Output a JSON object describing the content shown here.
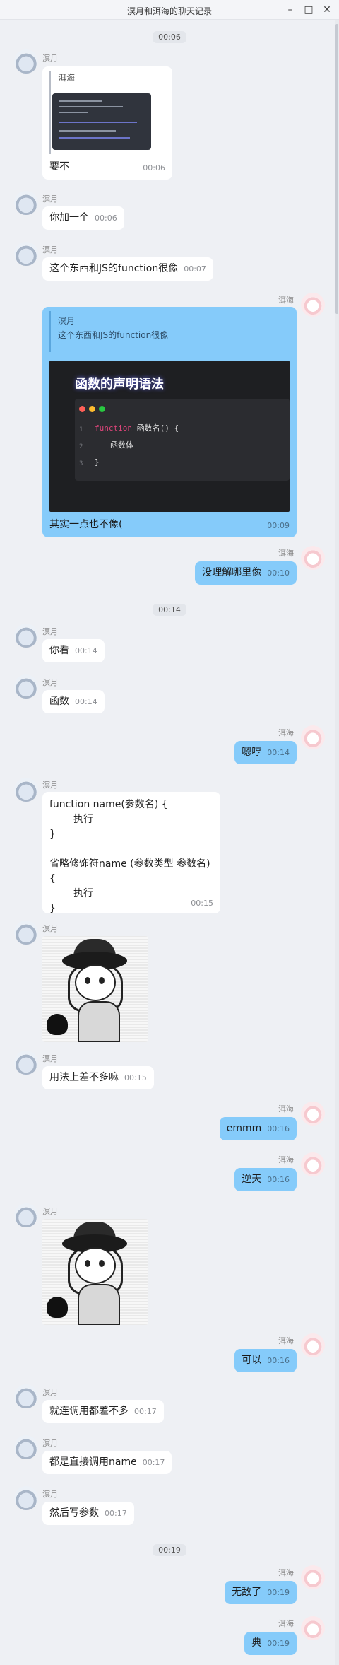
{
  "window": {
    "title": "溟月和洱海的聊天记录",
    "minimize_icon": "minimize-icon",
    "maximize_icon": "maximize-icon",
    "close_icon": "close-icon"
  },
  "users": {
    "left": "溟月",
    "right": "洱海"
  },
  "time_separators": [
    "00:06",
    "00:14",
    "00:19"
  ],
  "messages": [
    {
      "from": "left",
      "quote_name": "洱海",
      "text": "要不",
      "time": "00:06"
    },
    {
      "from": "left",
      "text": "你加一个",
      "time": "00:06"
    },
    {
      "from": "left",
      "text": "这个东西和JS的function很像",
      "time": "00:07"
    },
    {
      "from": "right",
      "quote_name": "溟月",
      "quote_text": "这个东西和JS的function很像",
      "text": "其实一点也不像(",
      "time": "00:09",
      "slide": {
        "heading": "函数的声明语法",
        "lines": [
          "1",
          "2",
          "3"
        ],
        "code_kw": "function",
        "code_rest": " 函数名() {",
        "code_body": "函数体",
        "code_close": "}"
      }
    },
    {
      "from": "right",
      "text": "没理解哪里像",
      "time": "00:10"
    },
    {
      "from": "left",
      "text": "你看",
      "time": "00:14"
    },
    {
      "from": "left",
      "text": "函数",
      "time": "00:14"
    },
    {
      "from": "right",
      "text": "嗯哼",
      "time": "00:14"
    },
    {
      "from": "left",
      "lines": [
        "function name(参数名) {",
        "执行",
        "}",
        "",
        "省略修饰符name (参数类型 参数名) {",
        "执行",
        "}"
      ],
      "time": "00:15"
    },
    {
      "from": "left",
      "image": "manga-image"
    },
    {
      "from": "left",
      "text": "用法上差不多嘛",
      "time": "00:15"
    },
    {
      "from": "right",
      "text": "emmm",
      "time": "00:16"
    },
    {
      "from": "right",
      "text": "逆天",
      "time": "00:16"
    },
    {
      "from": "left",
      "image": "manga-image"
    },
    {
      "from": "right",
      "text": "可以",
      "time": "00:16"
    },
    {
      "from": "left",
      "text": "就连调用都差不多",
      "time": "00:17"
    },
    {
      "from": "left",
      "text": "都是直接调用name",
      "time": "00:17"
    },
    {
      "from": "left",
      "text": "然后写参数",
      "time": "00:17"
    },
    {
      "from": "right",
      "text": "无敌了",
      "time": "00:19"
    },
    {
      "from": "right",
      "text": "典",
      "time": "00:19"
    }
  ]
}
